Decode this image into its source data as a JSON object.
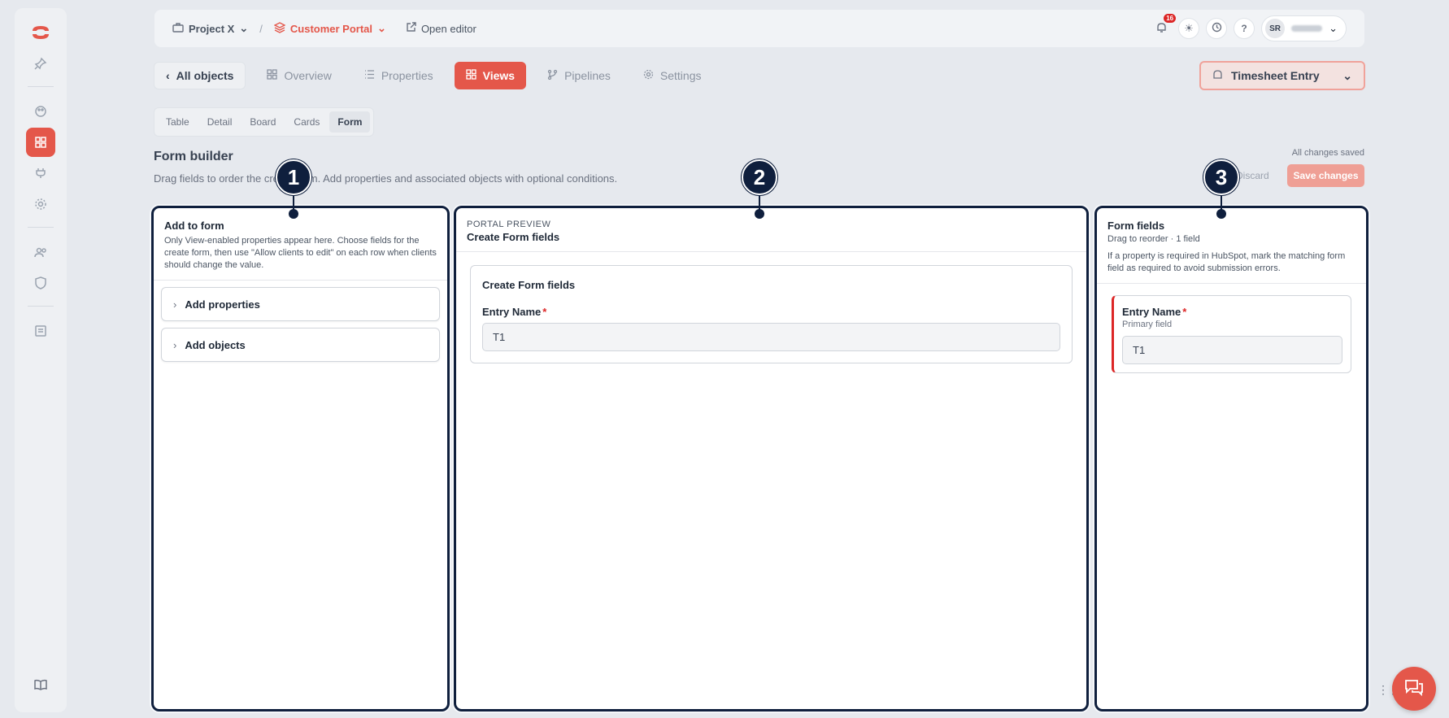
{
  "topbar": {
    "project": "Project X",
    "portal": "Customer Portal",
    "open_editor": "Open editor",
    "notification_count": "16",
    "user_initials": "SR"
  },
  "nav": {
    "back_label": "All objects",
    "tabs": [
      "Overview",
      "Properties",
      "Views",
      "Pipelines",
      "Settings"
    ],
    "active_tab": "Views",
    "object_selector": "Timesheet Entry"
  },
  "subtabs": {
    "items": [
      "Table",
      "Detail",
      "Board",
      "Cards",
      "Form"
    ],
    "active": "Form"
  },
  "form_builder": {
    "title": "Form builder",
    "description": "Drag fields to order the create form. Add properties and associated objects with optional conditions.",
    "saved_status": "All changes saved",
    "discard_label": "Discard",
    "save_label": "Save changes"
  },
  "panel_add": {
    "title": "Add to form",
    "description": "Only View-enabled properties appear here. Choose fields for the create form, then use \"Allow clients to edit\" on each row when clients should change the value.",
    "add_properties": "Add properties",
    "add_objects": "Add objects"
  },
  "panel_preview": {
    "kicker": "PORTAL PREVIEW",
    "title": "Create Form fields",
    "card_title": "Create Form fields",
    "field_label": "Entry Name",
    "field_value": "T1"
  },
  "panel_fields": {
    "title": "Form fields",
    "subtitle": "Drag to reorder · 1 field",
    "note": "If a property is required in HubSpot, mark the matching form field as required to avoid submission errors.",
    "field_label": "Entry Name",
    "field_sub": "Primary field",
    "field_value": "T1"
  },
  "markers": [
    "1",
    "2",
    "3"
  ],
  "colors": {
    "accent": "#e4574a",
    "callout": "#0f1f3d",
    "required": "#dc2626"
  }
}
